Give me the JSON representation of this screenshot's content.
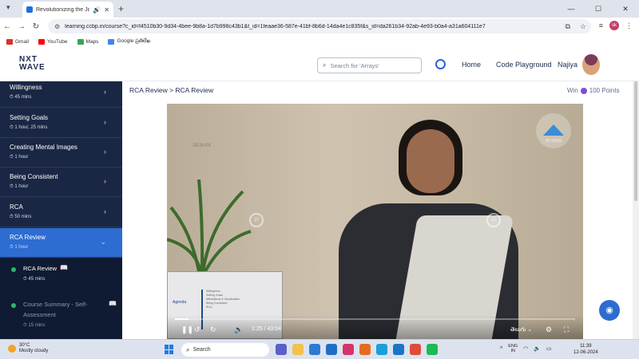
{
  "browser": {
    "tab_title": "Revolutionizing the Job Ma",
    "url": "learning.ccbp.in/course?c_id=f4510b30-9d34-4bee-9b8a-1d7b998c43b1&t_id=1feaae36-587e-41bf-8b6d-14da4e1c835f&s_id=da261b34-92ab-4e93-b0a4-a31a604111e7",
    "profile_initials": "sk",
    "bookmarks": [
      {
        "label": "Gmail",
        "color": "#d93025"
      },
      {
        "label": "YouTube",
        "color": "#ff0000"
      },
      {
        "label": "Maps",
        "color": "#34a853"
      },
      {
        "label": "Google ప్రతిలేఖ",
        "color": "#4285f4"
      }
    ]
  },
  "app": {
    "logo_line1": "NXT",
    "logo_line2": "WAVE",
    "search_placeholder": "Search for 'Arrays'",
    "nav": {
      "home": "Home",
      "playground": "Code Playground",
      "user": "Najiya"
    }
  },
  "sidebar": {
    "items": [
      {
        "title": "Willingness",
        "duration": "45 mins"
      },
      {
        "title": "Setting Goals",
        "duration": "1 hour, 25 mins"
      },
      {
        "title": "Creating Mental Images",
        "duration": "1 hour"
      },
      {
        "title": "Being Consistent",
        "duration": "1 hour"
      },
      {
        "title": "RCA",
        "duration": "50 mins"
      },
      {
        "title": "RCA Review",
        "duration": "1 hour"
      }
    ],
    "subitems": [
      {
        "title": "RCA Review",
        "duration": "45 mins"
      },
      {
        "title": "Course Summary - Self-",
        "title2": "Assessment",
        "duration": "15 mins"
      }
    ]
  },
  "content": {
    "breadcrumb": "RCA Review > RCA Review",
    "win_label": "Win",
    "points": "100 Points"
  },
  "video": {
    "watermark": "363c44",
    "badge_label": "IB HUBS",
    "skip_back": "10",
    "skip_fwd": "10",
    "slide_title": "Agenda",
    "slide_lines": [
      "Willingness",
      "Setting Goals",
      "Affirmations & Visualization",
      "Being Consistent",
      "RCA"
    ],
    "current_time": "1:25",
    "total_time": "43:04",
    "progress_fraction": 0.033,
    "language": "తెలుగు"
  },
  "taskbar": {
    "temperature": "30°C",
    "weather": "Mostly cloudy",
    "search_label": "Search",
    "lang_top": "ENG",
    "lang_bottom": "IN",
    "time": "11:39",
    "date": "12-06-2024"
  }
}
